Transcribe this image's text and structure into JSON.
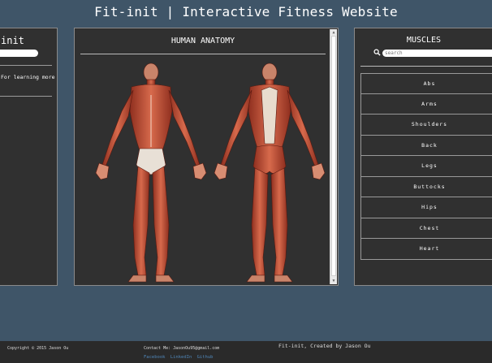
{
  "header": {
    "title": "Fit-init | Interactive Fitness Website"
  },
  "left_panel": {
    "title": "init",
    "text": "For learning more"
  },
  "center_panel": {
    "title": "HUMAN ANATOMY"
  },
  "right_panel": {
    "title": "MUSCLES",
    "search_placeholder": "search",
    "items": [
      "Abs",
      "Arms",
      "Shoulders",
      "Back",
      "Legs",
      "Buttocks",
      "Hips",
      "Chest",
      "Heart"
    ]
  },
  "footer": {
    "copyright": "Copyright © 2015 Jason Ou",
    "contact": "Contact Me: JasonOu95@gmail.com",
    "links": [
      "Facebook",
      "LinkedIn",
      "Github"
    ],
    "created": "Fit-init, Created by Jason Ou"
  },
  "colors": {
    "background": "#3f5568",
    "panel": "#303030",
    "muscle": "#c0543a",
    "footer_link": "#4f86b8"
  }
}
